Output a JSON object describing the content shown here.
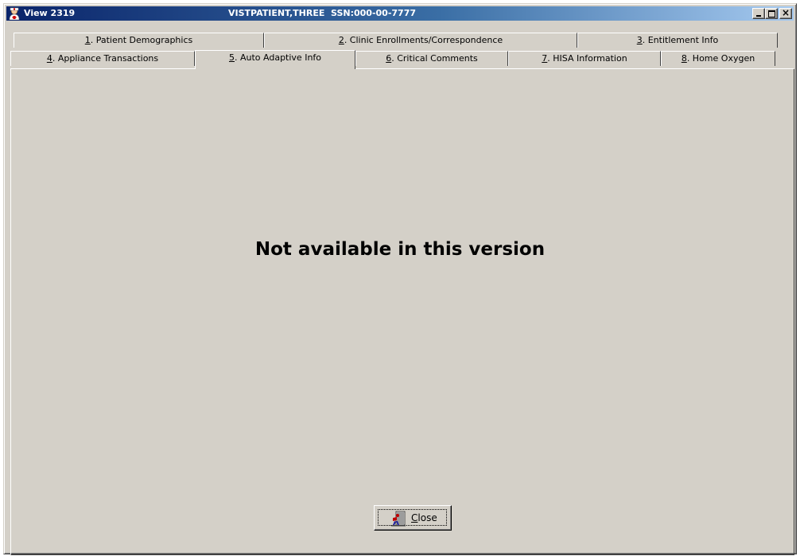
{
  "window": {
    "title": "View 2319",
    "patient_info": "VISTPATIENT,THREE  SSN:000-00-7777",
    "controls": {
      "minimize": "_",
      "maximize": "□",
      "close": "x"
    }
  },
  "tabs_row1": [
    {
      "key": "1",
      "rest": ". Patient Demographics"
    },
    {
      "key": "2",
      "rest": ". Clinic Enrollments/Correspondence"
    },
    {
      "key": "3",
      "rest": ". Entitlement Info"
    }
  ],
  "tabs_row2": [
    {
      "key": "4",
      "rest": ". Appliance Transactions"
    },
    {
      "key": "5",
      "rest": ". Auto Adaptive Info",
      "selected": true
    },
    {
      "key": "6",
      "rest": ". Critical Comments"
    },
    {
      "key": "7",
      "rest": ". HISA Information"
    },
    {
      "key": "8",
      "rest": ". Home Oxygen"
    }
  ],
  "content": {
    "message": "Not available in this version"
  },
  "close_button": {
    "key": "C",
    "rest": "lose",
    "icon": "door-exit-icon"
  },
  "colors": {
    "titlebar_start": "#0a246a",
    "titlebar_end": "#a6caf0",
    "face": "#d4d0c8"
  }
}
